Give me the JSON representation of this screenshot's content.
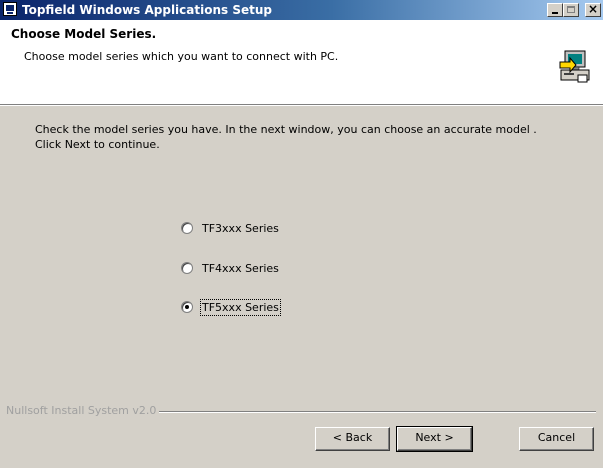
{
  "window": {
    "title": "Topfield Windows Applications Setup",
    "close_glyph": "×"
  },
  "header": {
    "title": "Choose Model Series.",
    "subtitle": "Choose model series which you want to connect with PC.",
    "icon": "installer-computer-icon"
  },
  "instructions": {
    "line1": "Check the model series you have. In the next window, you can choose an accurate model .",
    "line2": "Click Next to continue."
  },
  "options": [
    {
      "label": "TF3xxx Series",
      "checked": false
    },
    {
      "label": "TF4xxx Series",
      "checked": false
    },
    {
      "label": "TF5xxx Series",
      "checked": true
    }
  ],
  "footer": {
    "branding": "Nullsoft Install System v2.0",
    "back_label": "< Back",
    "next_label": "Next >",
    "cancel_label": "Cancel"
  }
}
